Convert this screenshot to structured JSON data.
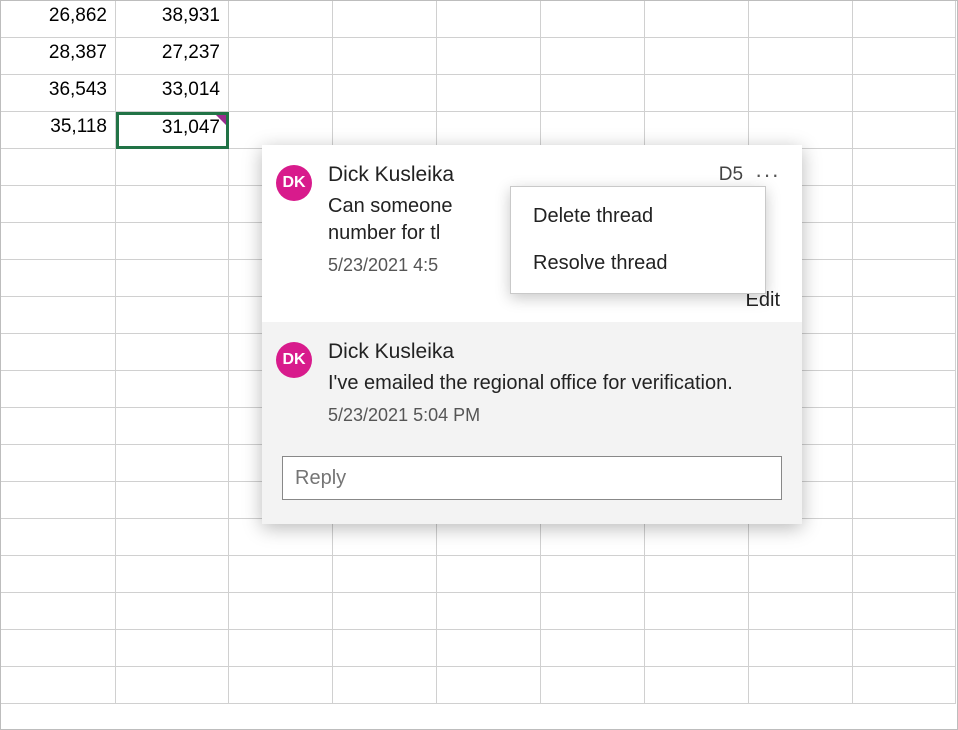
{
  "grid": {
    "rows": [
      [
        "26,862",
        "38,931",
        "",
        "",
        "",
        "",
        "",
        "",
        ""
      ],
      [
        "28,387",
        "27,237",
        "",
        "",
        "",
        "",
        "",
        "",
        ""
      ],
      [
        "36,543",
        "33,014",
        "",
        "",
        "",
        "",
        "",
        "",
        ""
      ],
      [
        "35,118",
        "31,047",
        "",
        "",
        "",
        "",
        "",
        "",
        ""
      ]
    ],
    "selected_cell_value": "31,047"
  },
  "thread": {
    "cell_ref": "D5",
    "comments": [
      {
        "avatar_initials": "DK",
        "author": "Dick Kusleika",
        "text": "Can someone verify the number for this month?",
        "text_visible": "Can someone number for tl",
        "timestamp": "5/23/2021 4:5",
        "edit_label": "Edit"
      },
      {
        "avatar_initials": "DK",
        "author": "Dick Kusleika",
        "text": "I've emailed the regional office for verification.",
        "timestamp": "5/23/2021 5:04 PM"
      }
    ],
    "reply_placeholder": "Reply"
  },
  "menu": {
    "items": [
      "Delete thread",
      "Resolve thread"
    ]
  },
  "icons": {
    "more": "···"
  }
}
